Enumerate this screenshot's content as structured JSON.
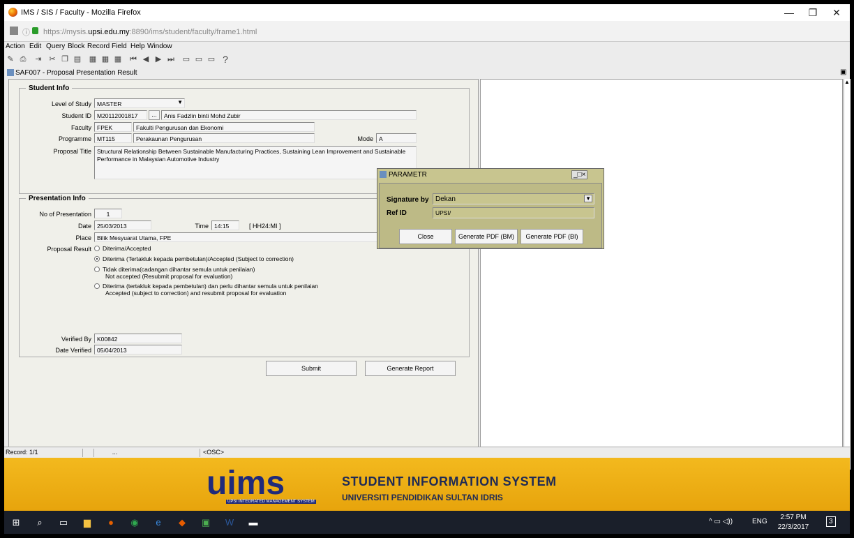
{
  "browser": {
    "window_title": "IMS / SIS / Faculty - Mozilla Firefox",
    "url_prefix": "https://mysis.",
    "url_domain": "upsi.edu.my",
    "url_suffix": ":8890/ims/student/faculty/frame1.html",
    "min_glyph": "—",
    "restore_glyph": "❐",
    "close_glyph": "✕"
  },
  "menu": [
    "Action",
    "Edit",
    "Query",
    "Block",
    "Record",
    "Field",
    "Help",
    "Window"
  ],
  "toolbar": {
    "help_glyph": "?"
  },
  "form": {
    "window_title": "SAF007 - Proposal Presentation Result",
    "student_info": {
      "legend": "Student Info",
      "level_label": "Level of Study",
      "level_value": "MASTER",
      "id_label": "Student ID",
      "id_value": "M20112001817",
      "lov_button": "...",
      "name_value": "Anis Fadzlin binti Mohd Zubir",
      "faculty_label": "Faculty",
      "faculty_code": "FPEK",
      "faculty_name": "Fakulti Pengurusan dan Ekonomi",
      "programme_label": "Programme",
      "programme_code": "MT115",
      "programme_name": "Perakaunan Pengurusan",
      "mode_label": "Mode",
      "mode_value": "A",
      "title_label": "Proposal Title",
      "title_value": "Structural Relationship Between Sustainable Manufacturing Practices, Sustaining Lean Improvement and Sustainable Performance in Malaysian Automotive Industry"
    },
    "presentation_info": {
      "legend": "Presentation Info",
      "no_label": "No of Presentation",
      "no_value": "1",
      "date_label": "Date",
      "date_value": "25/03/2013",
      "time_label": "Time",
      "time_value": "14:15",
      "time_format": "[ HH24:MI ]",
      "place_label": "Place",
      "place_value": "Bilik Mesyuarat Utama, FPE",
      "result_label": "Proposal Result",
      "options": [
        {
          "line1": "Diterima/Accepted",
          "line2": "",
          "selected": false
        },
        {
          "line1": "Diterima (Tertakluk kepada pembetulan)/Accepted (Subject to correction)",
          "line2": "",
          "selected": true
        },
        {
          "line1": "Tidak diterima(cadangan dihantar semula untuk penilaian)",
          "line2": "Not accepted (Resubmit proposal for evaluation)",
          "selected": false
        },
        {
          "line1": "Diterima (tertakluk kepada pembetulan) dan perlu dihantar semula untuk penilaian",
          "line2": "Accepted (subject to correction) and resubmit proposal for evaluation",
          "selected": false
        }
      ],
      "verified_by_label": "Verified By",
      "verified_by_value": "K00842",
      "date_verified_label": "Date Verified",
      "date_verified_value": "05/04/2013"
    },
    "buttons": {
      "submit": "Submit",
      "generate_report": "Generate Report"
    }
  },
  "dialog": {
    "title": "PARAMETR",
    "title_buttons": "_□×",
    "signature_label": "Signature by",
    "signature_value": "Dekan",
    "ref_label": "Ref ID",
    "ref_value": "UPSI/",
    "close": "Close",
    "pdf_bm": "Generate PDF (BM)",
    "pdf_bi": "Generate PDF (BI)"
  },
  "status": {
    "record": "Record: 1/1",
    "cell2": "...",
    "cell3": "<OSC>"
  },
  "banner": {
    "logo_text": "uims",
    "logo_sub": "UPSI INTEGRATED MANAGEMENT SYSTEM",
    "title": "STUDENT INFORMATION SYSTEM",
    "subtitle": "UNIVERSITI PENDIDIKAN SULTAN IDRIS"
  },
  "taskbar": {
    "lang": "ENG",
    "time": "2:57 PM",
    "date": "22/3/2017",
    "notif_count": "3"
  },
  "colors": {
    "dialog_bg": "#c8c58f",
    "banner": "#f0b21a",
    "taskbar": "#1a1f2a"
  }
}
